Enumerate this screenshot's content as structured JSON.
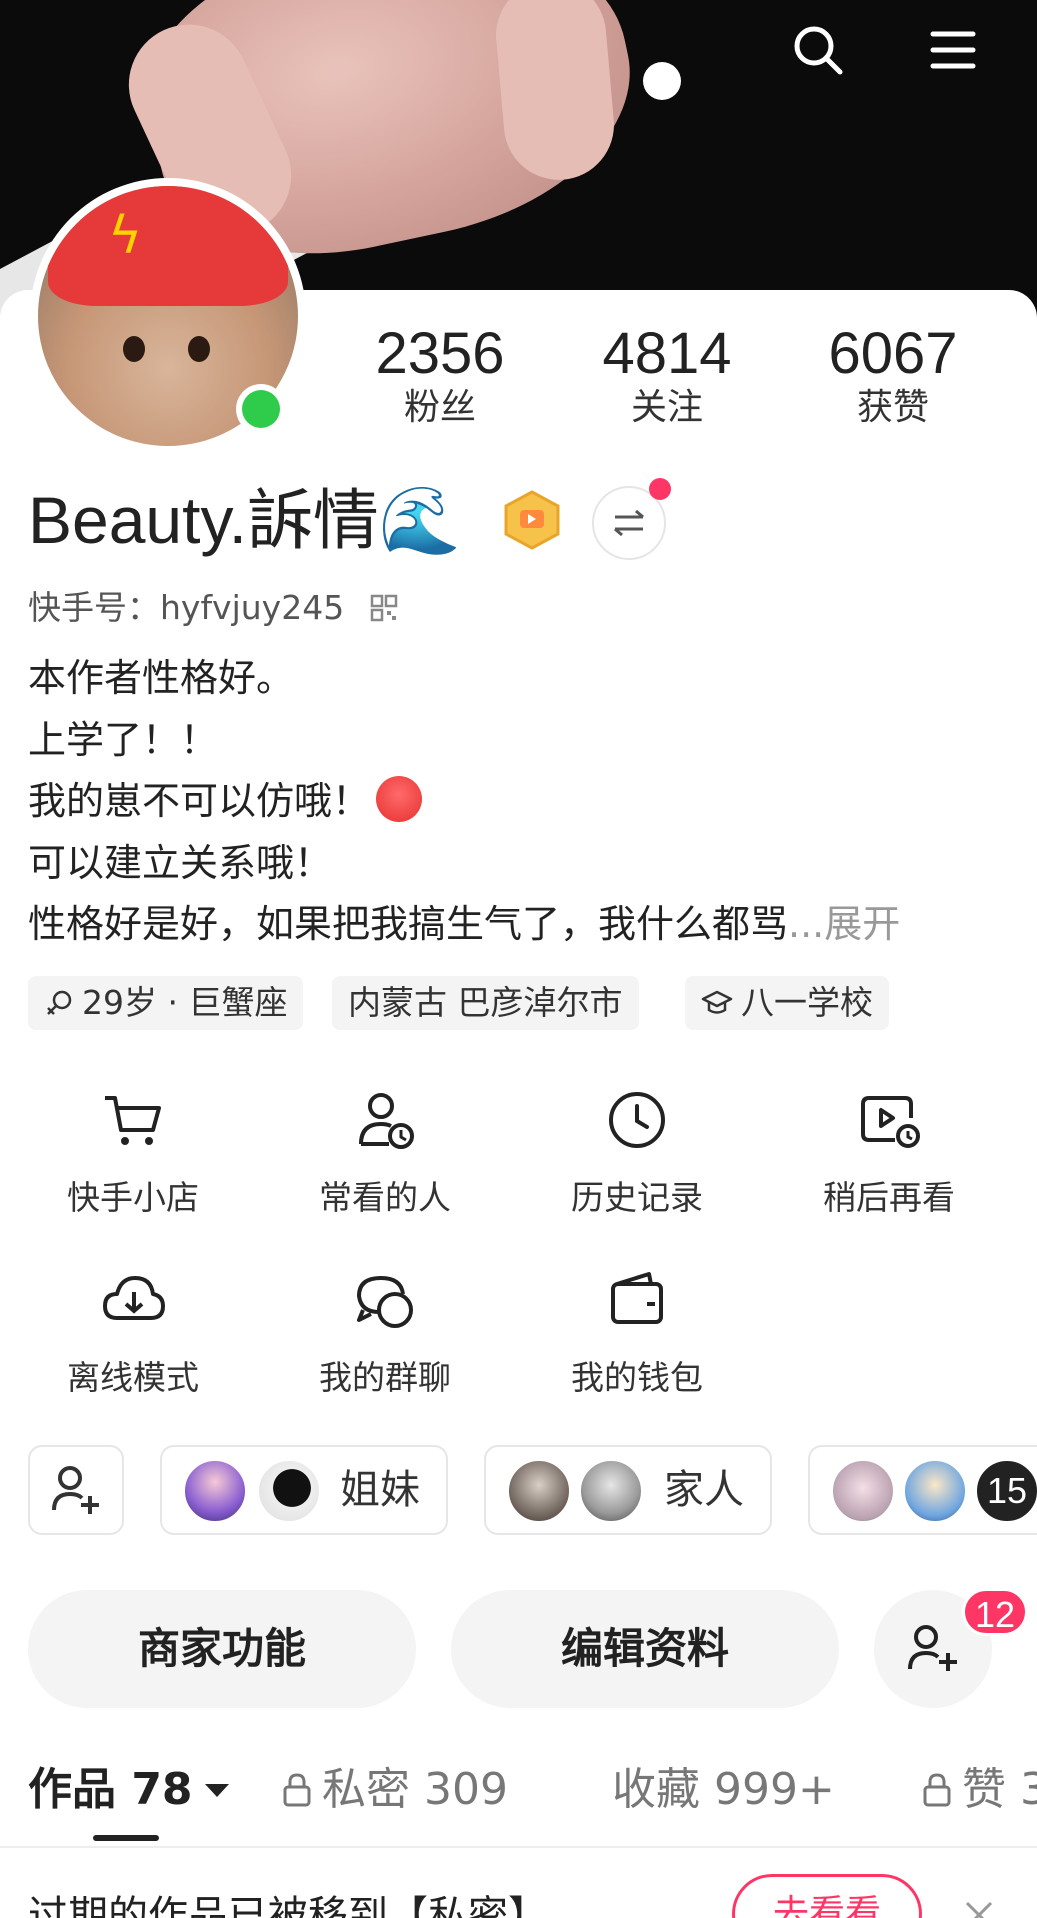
{
  "header": {
    "icons": [
      "search-icon",
      "menu-icon"
    ]
  },
  "profile": {
    "stats": [
      {
        "value": "2356",
        "label": "粉丝"
      },
      {
        "value": "4814",
        "label": "关注"
      },
      {
        "value": "6067",
        "label": "获赞"
      }
    ],
    "name": "Beauty.訴情🌊",
    "kuaishou_id": "快手号：hyfvjuy245",
    "bio": [
      "本作者性格好。",
      "上学了！！",
      "我的崽不可以仿哦！",
      "可以建立关系哦！",
      "性格好是好，如果把我搞生气了，我什么都骂"
    ],
    "expand_label": "...展开",
    "tags": [
      "29岁 · 巨蟹座",
      "内蒙古 巴彦淖尔市",
      "八一学校"
    ]
  },
  "features": [
    {
      "label": "快手小店",
      "icon": "cart-icon"
    },
    {
      "label": "常看的人",
      "icon": "frequent-people-icon"
    },
    {
      "label": "历史记录",
      "icon": "clock-icon"
    },
    {
      "label": "稍后再看",
      "icon": "watch-later-icon"
    },
    {
      "label": "离线模式",
      "icon": "download-icon"
    },
    {
      "label": "我的群聊",
      "icon": "group-chat-icon"
    },
    {
      "label": "我的钱包",
      "icon": "wallet-icon"
    }
  ],
  "relations": {
    "chips": [
      {
        "label": "姐妹"
      },
      {
        "label": "家人"
      },
      {
        "label": "15"
      }
    ]
  },
  "actions": {
    "merchant_label": "商家功能",
    "edit_label": "编辑资料",
    "friend_request_count": "12"
  },
  "tabs": [
    {
      "label": "作品 78",
      "active": true
    },
    {
      "label": "私密 309",
      "locked": true
    },
    {
      "label": "收藏 999+"
    },
    {
      "label": "赞 3",
      "locked": true
    }
  ],
  "notice": {
    "text": "过期的作品已被移到【私密】",
    "button_label": "去看看"
  },
  "colors": {
    "accent": "#fe3666",
    "online": "#2fcc4b",
    "chip_bg": "#f4f4f4"
  }
}
